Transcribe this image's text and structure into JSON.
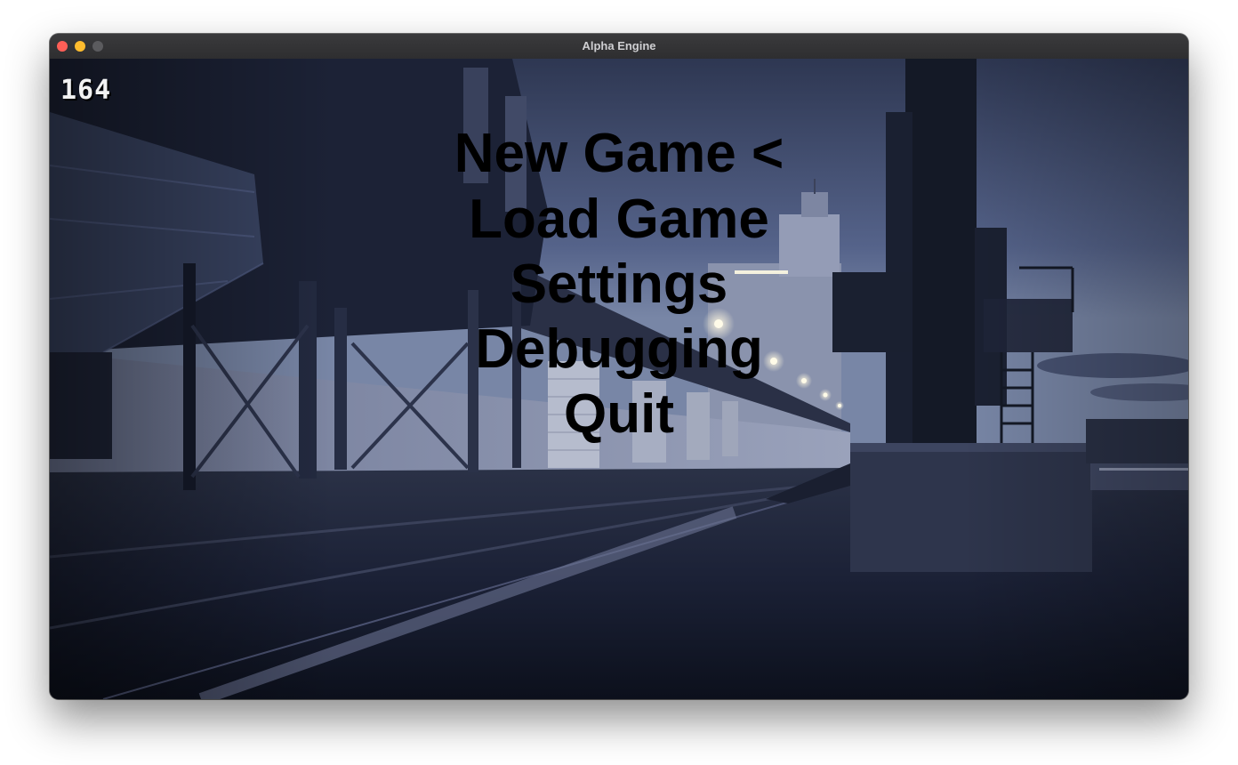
{
  "window": {
    "title": "Alpha Engine"
  },
  "hud": {
    "fps_counter": "164"
  },
  "menu": {
    "items": [
      {
        "label": "New Game <",
        "selected": true
      },
      {
        "label": "Load Game",
        "selected": false
      },
      {
        "label": "Settings",
        "selected": false
      },
      {
        "label": "Debugging",
        "selected": false
      },
      {
        "label": "Quit",
        "selected": false
      }
    ]
  },
  "colors": {
    "sky": "#5c6a8c",
    "ground": "#1a2035",
    "menu_text": "#000000",
    "hud_text": "#f2f2f2",
    "close_light": "#fe5f57",
    "minimize_light": "#febc2e",
    "zoom_light": "#5b5b5e"
  }
}
